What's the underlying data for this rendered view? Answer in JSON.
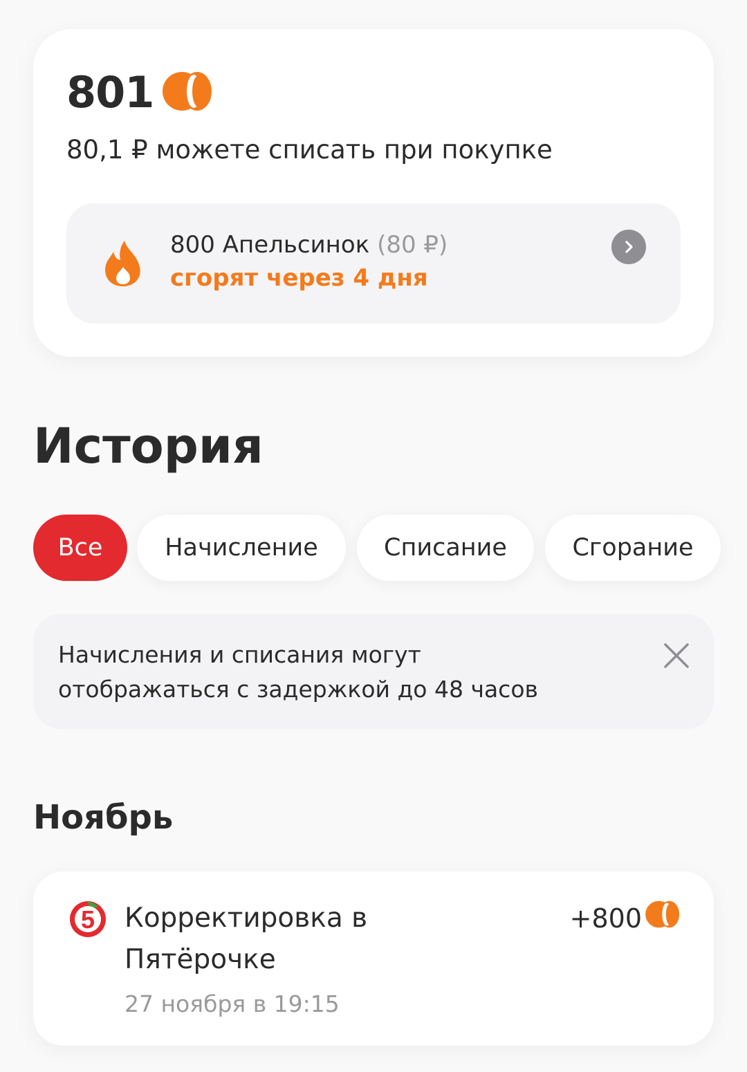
{
  "balance": {
    "points": "801",
    "subtitle": "80,1 ₽ можете списать при покупке",
    "burn": {
      "amount_label": "800 Апельсинок",
      "rub_value": "(80 ₽)",
      "expires_label": "сгорят через 4 дня"
    }
  },
  "history": {
    "title": "История",
    "filters": [
      {
        "label": "Все",
        "active": true
      },
      {
        "label": "Начисление",
        "active": false
      },
      {
        "label": "Списание",
        "active": false
      },
      {
        "label": "Сгорание",
        "active": false
      }
    ],
    "notice": "Начисления и списания могут отображаться с задержкой до 48 часов",
    "month": "Ноябрь",
    "transactions": [
      {
        "title": "Корректировка в Пятёрочке",
        "date": "27 ноября в 19:15",
        "amount": "+800",
        "store_logo_text": "5"
      }
    ]
  },
  "colors": {
    "accent_red": "#e32a2f",
    "accent_orange": "#f37b1c",
    "muted_text": "#9a9a9a"
  },
  "icons": {
    "coin": "orange-coin-icon",
    "fire": "fire-icon",
    "arrow": "chevron-right-icon",
    "close": "close-icon",
    "store": "pyaterochka-logo-icon"
  }
}
